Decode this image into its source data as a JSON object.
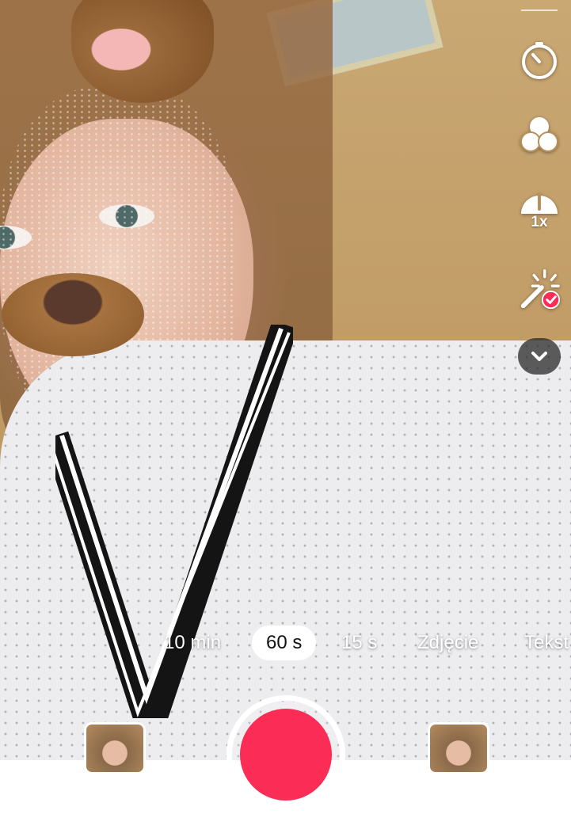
{
  "camera": {
    "modes": [
      {
        "label": "10 min",
        "active": false
      },
      {
        "label": "60 s",
        "active": true
      },
      {
        "label": "15 s",
        "active": false
      },
      {
        "label": "Zdjęcie",
        "active": false
      },
      {
        "label": "Tekst",
        "active": false
      }
    ]
  },
  "toolbar": {
    "icons": [
      "timer-icon",
      "filters-icon",
      "speed-icon",
      "beauty-effect-icon",
      "chevron-down-icon"
    ],
    "speed_label": "1x"
  },
  "colors": {
    "record": "#fb2c55",
    "active_pill": "#ffffff"
  }
}
